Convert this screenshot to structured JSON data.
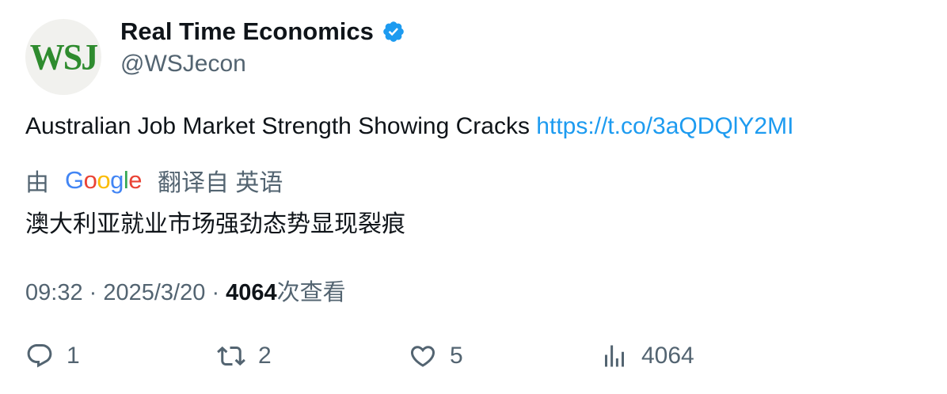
{
  "author": {
    "avatar_text": "WSJ",
    "display_name": "Real Time Economics",
    "handle": "@WSJecon",
    "verified": true
  },
  "tweet": {
    "text": "Australian Job Market Strength Showing Cracks",
    "link": "https://t.co/3aQDQlY2MI"
  },
  "translation": {
    "prefix": "由",
    "provider": "Google",
    "suffix": "翻译自 英语",
    "text": "澳大利亚就业市场强劲态势显现裂痕"
  },
  "meta": {
    "time": "09:32",
    "separator": "·",
    "date": "2025/3/20",
    "views_count": "4064",
    "views_label": "次查看"
  },
  "actions": {
    "reply_count": "1",
    "retweet_count": "2",
    "like_count": "5",
    "views_count": "4064"
  },
  "colors": {
    "link": "#1d9bf0",
    "secondary_text": "#536471",
    "primary_text": "#0f1419",
    "verified_badge": "#1d9bf0",
    "avatar_logo": "#2e8b2e"
  },
  "icons": [
    "verified-badge-icon",
    "reply-icon",
    "retweet-icon",
    "like-icon",
    "views-icon"
  ]
}
